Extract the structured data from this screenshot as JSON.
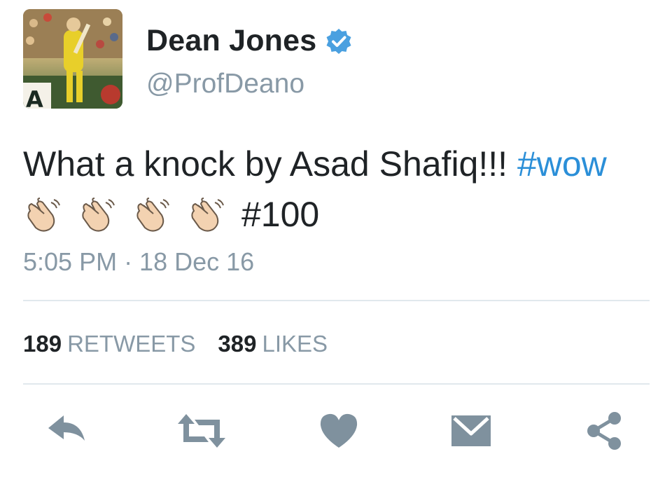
{
  "user": {
    "name": "Dean Jones",
    "handle": "@ProfDeano",
    "avatar_icon": "cricketer-avatar",
    "verified_icon": "verified-badge-icon"
  },
  "tweet": {
    "text_part1": "What a knock by Asad Shafiq!!! ",
    "hashtag1": "#wow",
    "emoji": [
      "👏",
      "👏",
      "👏",
      "👏"
    ],
    "hashtag2": "#100"
  },
  "timestamp": "5:05 PM · 18 Dec 16",
  "stats": {
    "retweets_count": "189",
    "retweets_label": "RETWEETS",
    "likes_count": "389",
    "likes_label": "LIKES"
  },
  "actions": [
    "reply-icon",
    "retweet-icon",
    "like-icon",
    "message-icon",
    "share-icon"
  ],
  "colors": {
    "hashtag": "#2b8fd8",
    "muted": "#8899a6",
    "icon": "#7f919e",
    "verified": "#4aa0e0"
  }
}
